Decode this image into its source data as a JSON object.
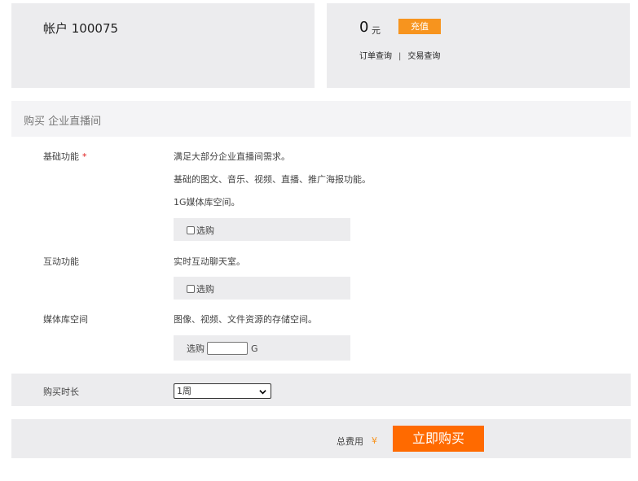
{
  "account": {
    "title": "帐户 100075"
  },
  "balance": {
    "amount": "0",
    "unit": "元",
    "recharge_label": "充值",
    "order_query": "订单查询",
    "separator": "|",
    "transaction_query": "交易查询"
  },
  "section": {
    "title": "购买 企业直播间"
  },
  "features": {
    "basic": {
      "label": "基础功能",
      "required_mark": "*",
      "lines": [
        "满足大部分企业直播间需求。",
        "基础的图文、音乐、视频、直播、推广海报功能。",
        "1G媒体库空间。"
      ],
      "option_label": "选购"
    },
    "interactive": {
      "label": "互动功能",
      "lines": [
        "实时互动聊天室。"
      ],
      "option_label": "选购"
    },
    "storage": {
      "label": "媒体库空间",
      "lines": [
        "图像、视频、文件资源的存储空间。"
      ],
      "option_label": "选购",
      "input_value": "",
      "unit": "G"
    }
  },
  "duration": {
    "label": "购买时长",
    "selected": "1周"
  },
  "total": {
    "label": "总费用",
    "currency_symbol": "¥",
    "buy_label": "立即购买"
  },
  "colors": {
    "accent_orange": "#f7941e",
    "buy_orange": "#ff6a00",
    "panel_gray": "#ececee"
  }
}
